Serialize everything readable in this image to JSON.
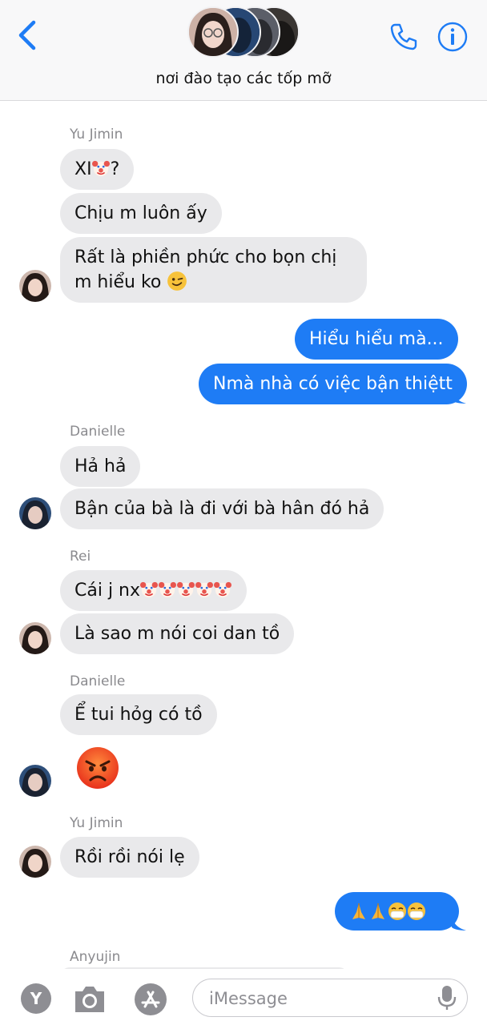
{
  "header": {
    "group_name": "nơi đào tạo các tốp mỡ",
    "back_icon": "chevron-left-icon",
    "call_icon": "phone-icon",
    "info_icon": "info-icon",
    "accent_color": "#1e7cf5"
  },
  "messages": [
    {
      "sender": "Yu Jimin"
    },
    {
      "text": "XI",
      "suffix": "?",
      "emojis": [
        "clown"
      ]
    },
    {
      "text": "Chịu m luôn ấy"
    },
    {
      "text": "Rất là phiền phức cho bọn chị m hiểu ko",
      "emojis": [
        "wink"
      ]
    },
    {
      "text": "Hiểu hiểu mà..."
    },
    {
      "text": "Nmà nhà có việc bận thiệtt"
    },
    {
      "sender": "Danielle"
    },
    {
      "text": "Hả hả"
    },
    {
      "text": "Bận của bà là đi với bà hân đó hả"
    },
    {
      "sender": "Rei"
    },
    {
      "text": "Cái j nx",
      "emojis": [
        "clown",
        "clown",
        "clown",
        "clown",
        "clown"
      ]
    },
    {
      "text": "Là sao m nói coi dan tồ"
    },
    {
      "sender": "Danielle"
    },
    {
      "text": "Ể tui hỏg có tồ"
    },
    {
      "emojis": [
        "angry-face"
      ]
    },
    {
      "sender": "Yu Jimin"
    },
    {
      "text": "Rồi rồi nói lẹ"
    },
    {
      "emojis": [
        "folded-hands",
        "folded-hands",
        "mask-face",
        "mask-face"
      ]
    },
    {
      "sender": "Anyujin"
    }
  ],
  "input_bar": {
    "app_button_label": "Y",
    "camera_icon": "camera-icon",
    "appstore_icon": "app-store-icon",
    "placeholder": "iMessage",
    "mic_icon": "microphone-icon"
  },
  "colors": {
    "incoming_bubble": "#e9e9eb",
    "outgoing_bubble": "#1e7cf5"
  }
}
